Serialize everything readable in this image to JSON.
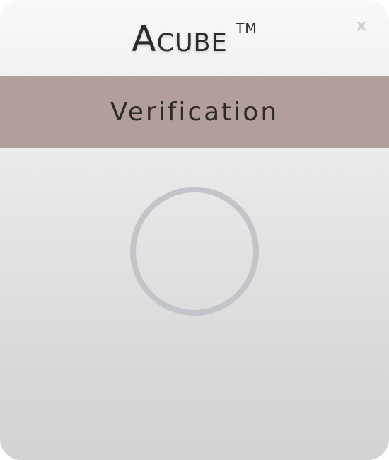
{
  "app": {
    "brand_name": "Acube",
    "brand_mark": "TM"
  },
  "header": {
    "close_label": "x"
  },
  "banner": {
    "title": "Verification"
  },
  "spinner": {
    "icon": "loading-ring-icon"
  },
  "colors": {
    "banner_bg": "#b29e9b",
    "ring": "#c1c4c8",
    "text": "#2b2b2b"
  }
}
